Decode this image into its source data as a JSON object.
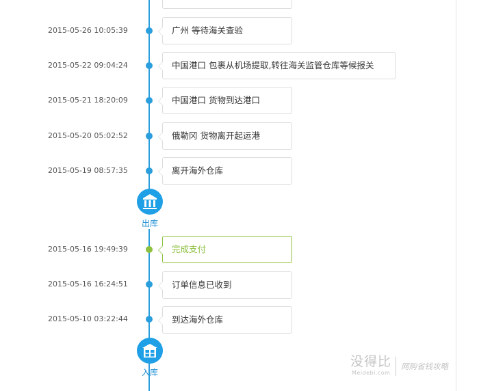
{
  "timeline": {
    "events_before": [
      {
        "time": "2015-05-26 10:05:39",
        "text": "广州 等待海关查验"
      },
      {
        "time": "2015-05-22 09:04:24",
        "text": "中国港口 包裹从机场提取,转往海关监管仓库等候报关"
      },
      {
        "time": "2015-05-21 18:20:09",
        "text": "中国港口 货物到达港口"
      },
      {
        "time": "2015-05-20 05:02:52",
        "text": "俄勒冈 货物离开起运港"
      },
      {
        "time": "2015-05-19 08:57:35",
        "text": "离开海外仓库"
      }
    ],
    "stage_out": {
      "label": "出库",
      "icon": "warehouse-out-icon"
    },
    "events_after": [
      {
        "time": "2015-05-16 19:49:39",
        "text": "完成支付",
        "highlight": true
      },
      {
        "time": "2015-05-16 16:24:51",
        "text": "订单信息已收到"
      },
      {
        "time": "2015-05-10 03:22:44",
        "text": "到达海外仓库"
      }
    ],
    "stage_in": {
      "label": "入库",
      "icon": "warehouse-in-icon"
    }
  },
  "watermark": {
    "main": "没得比",
    "sub": "Meidebi.com",
    "slogan": "网购省钱攻略"
  },
  "colors": {
    "accent_blue": "#2b9ede",
    "highlight_green": "#8dc03f",
    "box_border": "#dcdcdc"
  }
}
